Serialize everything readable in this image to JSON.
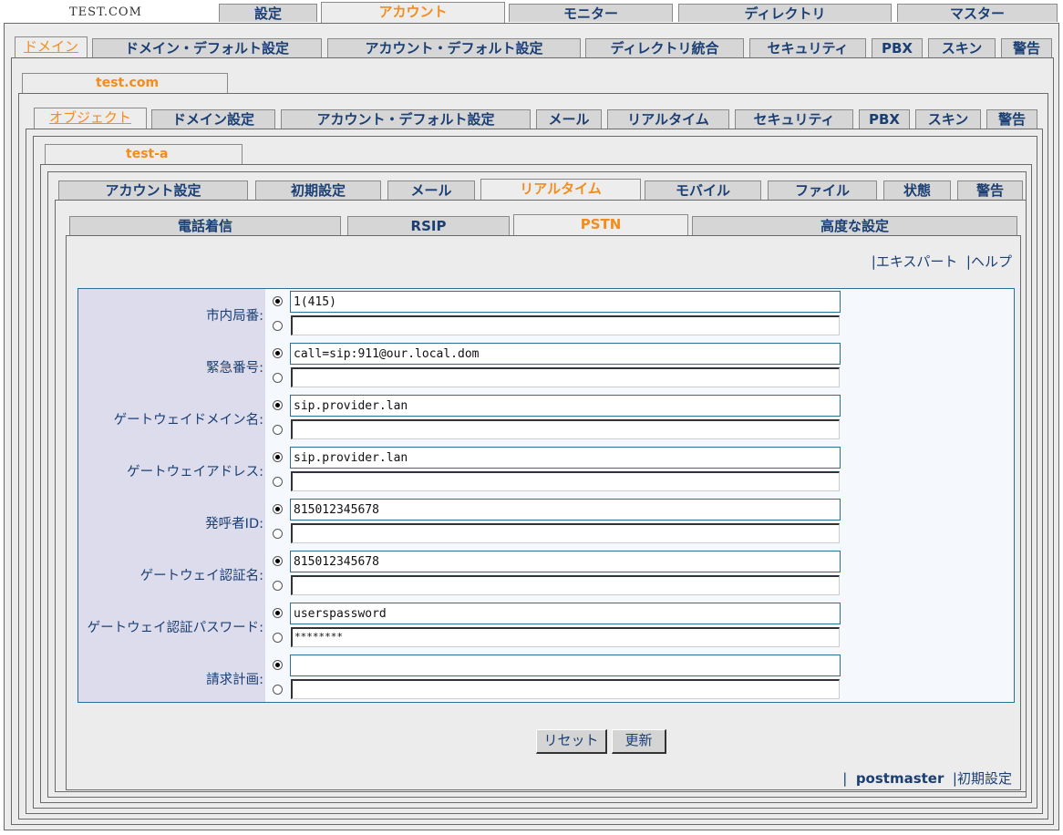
{
  "brand": "TEST.COM",
  "top_tabs": [
    "設定",
    "アカウント",
    "モニター",
    "ディレクトリ",
    "マスター"
  ],
  "domain_tabs": [
    "ドメイン",
    "ドメイン・デフォルト設定",
    "アカウント・デフォルト設定",
    "ディレクトリ統合",
    "セキュリティ",
    "PBX",
    "スキン",
    "警告"
  ],
  "domain_name": "test.com",
  "object_tabs": [
    "オブジェクト",
    "ドメイン設定",
    "アカウント・デフォルト設定",
    "メール",
    "リアルタイム",
    "セキュリティ",
    "PBX",
    "スキン",
    "警告"
  ],
  "account_name": "test-a",
  "account_tabs": [
    "アカウント設定",
    "初期設定",
    "メール",
    "リアルタイム",
    "モバイル",
    "ファイル",
    "状態",
    "警告"
  ],
  "sub_tabs": [
    "電話着信",
    "RSIP",
    "PSTN",
    "高度な設定"
  ],
  "links": {
    "expert": "エキスパート",
    "help": "ヘルプ",
    "user": "postmaster",
    "prefs": "初期設定"
  },
  "fields": [
    {
      "label": "市内局番:",
      "value": "1(415)",
      "alt": ""
    },
    {
      "label": "緊急番号:",
      "value": "call=sip:911@our.local.dom",
      "alt": ""
    },
    {
      "label": "ゲートウェイドメイン名:",
      "value": "sip.provider.lan",
      "alt": ""
    },
    {
      "label": "ゲートウェイアドレス:",
      "value": "sip.provider.lan",
      "alt": ""
    },
    {
      "label": "発呼者ID:",
      "value": "815012345678",
      "alt": ""
    },
    {
      "label": "ゲートウェイ認証名:",
      "value": "815012345678",
      "alt": ""
    },
    {
      "label": "ゲートウェイ認証パスワード:",
      "value": "userspassword",
      "alt": "********"
    },
    {
      "label": "請求計画:",
      "value": "",
      "alt": ""
    }
  ],
  "buttons": {
    "reset": "リセット",
    "update": "更新"
  }
}
